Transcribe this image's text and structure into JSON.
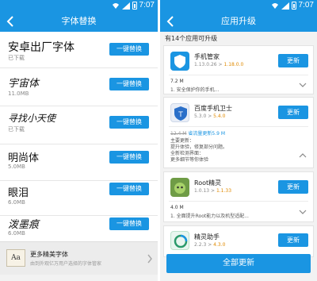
{
  "left": {
    "status_time": "7:07",
    "title": "字体替换",
    "button_label": "一键替换",
    "fonts": [
      {
        "name": "安卓出厂字体",
        "sub": "已下载"
      },
      {
        "name": "宇宙体",
        "sub": "11.0MB"
      },
      {
        "name": "寻找小天使",
        "sub": "已下载"
      },
      {
        "name": "明尚体",
        "sub": "5.0MB"
      },
      {
        "name": "眼泪",
        "sub": "6.0MB"
      },
      {
        "name": "泼墨痕",
        "sub": "6.0MB"
      }
    ],
    "more": {
      "icon_text": "Aa",
      "title": "更多精美字体",
      "sub": "由到外观亿万用户选择的字体管家"
    }
  },
  "right": {
    "status_time": "7:07",
    "title": "应用升级",
    "count_text": "有14个应用可升级",
    "update_label": "更新",
    "update_all_label": "全部更新",
    "apps": [
      {
        "name": "手机管家",
        "ver_old": "1.13.0.26",
        "arrow": " > ",
        "ver_new": "1.18.0.0",
        "size": "7.2 M",
        "note": "1. 安全保护你的手机...",
        "icon_color": "#1a95e2"
      },
      {
        "name": "百度手机卫士",
        "ver_old": "5.3.0",
        "arrow": " > ",
        "ver_new": "5.4.0",
        "save_old": "12.4 M",
        "save_text": "省流量更新5.9 M",
        "notes": [
          "主要更新：",
          "提升体验，修复部分问题。",
          "全新检测界面：",
          "更多细节等你体验"
        ],
        "icon_color": "#2a6fc9"
      },
      {
        "name": "Root精灵",
        "ver_old": "1.0.13",
        "arrow": " > ",
        "ver_new": "1.1.33",
        "size": "4.0 M",
        "note": "1. 全面提升Root能力以及机型适配...",
        "icon_color": "#5c8a3a"
      },
      {
        "name": "精灵助手",
        "ver_old": "2.2.3",
        "arrow": " > ",
        "ver_new": "4.3.0",
        "icon_color": "#2a9a6a"
      }
    ]
  }
}
